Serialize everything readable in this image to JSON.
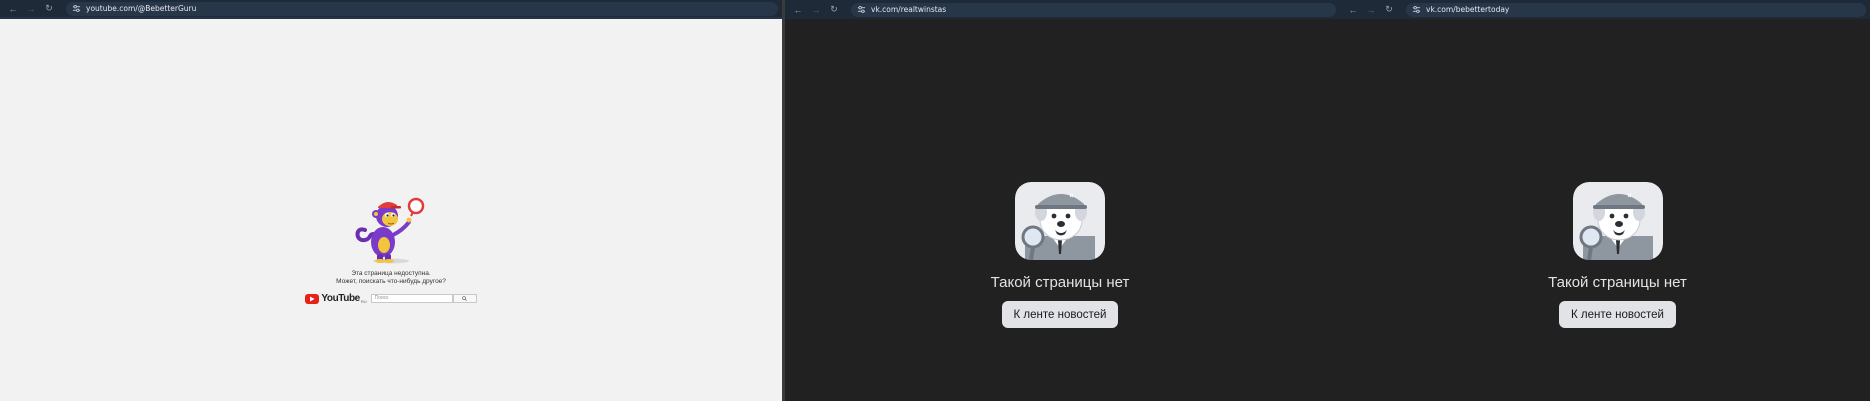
{
  "windows": [
    {
      "url": "youtube.com/@BebetterGuru",
      "page": {
        "message_line1": "Эта страница недоступна.",
        "message_line2": "Может, поискать что-нибудь другое?",
        "search_placeholder": "Поиск",
        "logo_text": "YouTube",
        "logo_suffix": "RU"
      }
    },
    {
      "url": "vk.com/realtwinstas",
      "page": {
        "title": "Такой страницы нет",
        "button_label": "К ленте новостей"
      }
    },
    {
      "url": "vk.com/bebettertoday",
      "page": {
        "title": "Такой страницы нет",
        "button_label": "К ленте новостей"
      }
    }
  ],
  "icons": {
    "back": "arrow-left-icon",
    "forward": "arrow-right-icon",
    "reload": "reload-icon",
    "site_info": "tune-icon",
    "search": "magnifier-icon"
  },
  "colors": {
    "toolbar": "#1f2a38",
    "youtube_bg": "#f2f2f2",
    "vk_bg": "#212121",
    "vk_button": "#e1e3e6",
    "youtube_red": "#e62117"
  }
}
